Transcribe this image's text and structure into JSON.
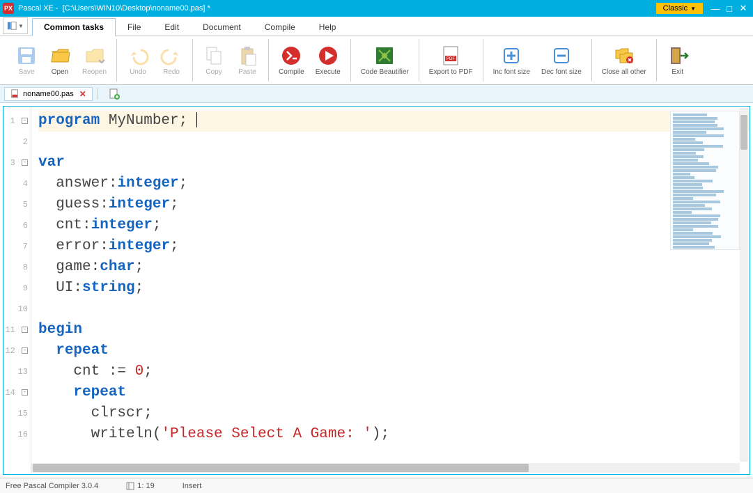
{
  "window": {
    "app_name": "Pascal XE",
    "file_path": "[C:\\Users\\WIN10\\Desktop\\noname00.pas] *",
    "theme_button": "Classic"
  },
  "menu": {
    "tabs": [
      "Common tasks",
      "File",
      "Edit",
      "Document",
      "Compile",
      "Help"
    ],
    "active_index": 0
  },
  "toolbar": {
    "groups": [
      {
        "items": [
          {
            "name": "save",
            "label": "Save",
            "icon": "save-icon",
            "disabled": true
          },
          {
            "name": "open",
            "label": "Open",
            "icon": "folder-open-icon",
            "disabled": false
          },
          {
            "name": "reopen",
            "label": "Reopen",
            "icon": "folder-dropdown-icon",
            "disabled": true
          }
        ]
      },
      {
        "items": [
          {
            "name": "undo",
            "label": "Undo",
            "icon": "undo-icon",
            "disabled": true
          },
          {
            "name": "redo",
            "label": "Redo",
            "icon": "redo-icon",
            "disabled": true
          }
        ]
      },
      {
        "items": [
          {
            "name": "copy",
            "label": "Copy",
            "icon": "copy-icon",
            "disabled": true
          },
          {
            "name": "paste",
            "label": "Paste",
            "icon": "paste-icon",
            "disabled": true
          }
        ]
      },
      {
        "items": [
          {
            "name": "compile",
            "label": "Compile",
            "icon": "compile-icon",
            "disabled": false
          },
          {
            "name": "execute",
            "label": "Execute",
            "icon": "execute-icon",
            "disabled": false
          }
        ]
      },
      {
        "items": [
          {
            "name": "code-beautifier",
            "label": "Code Beautifier",
            "icon": "beautifier-icon",
            "disabled": false
          }
        ]
      },
      {
        "items": [
          {
            "name": "export-pdf",
            "label": "Export to PDF",
            "icon": "pdf-icon",
            "disabled": false
          }
        ]
      },
      {
        "items": [
          {
            "name": "inc-font",
            "label": "Inc font size",
            "icon": "plus-icon",
            "disabled": false
          },
          {
            "name": "dec-font",
            "label": "Dec font size",
            "icon": "minus-icon",
            "disabled": false
          }
        ]
      },
      {
        "items": [
          {
            "name": "close-all-other",
            "label": "Close all other",
            "icon": "close-folders-icon",
            "disabled": false
          }
        ]
      },
      {
        "items": [
          {
            "name": "exit",
            "label": "Exit",
            "icon": "exit-icon",
            "disabled": false
          }
        ]
      }
    ]
  },
  "file_tabs": {
    "tabs": [
      {
        "name": "noname00.pas",
        "modified": true
      }
    ]
  },
  "editor": {
    "lines": [
      {
        "n": 1,
        "fold": "-",
        "tokens": [
          [
            "kw",
            "program"
          ],
          [
            "ident",
            " MyNumber"
          ],
          [
            "punct",
            ";"
          ]
        ],
        "hl": true,
        "caret_after": true
      },
      {
        "n": 2,
        "tokens": []
      },
      {
        "n": 3,
        "fold": "-",
        "tokens": [
          [
            "kw",
            "var"
          ]
        ]
      },
      {
        "n": 4,
        "tokens": [
          [
            "ident",
            "  answer"
          ],
          [
            "punct",
            ":"
          ],
          [
            "type",
            "integer"
          ],
          [
            "punct",
            ";"
          ]
        ]
      },
      {
        "n": 5,
        "tokens": [
          [
            "ident",
            "  guess"
          ],
          [
            "punct",
            ":"
          ],
          [
            "type",
            "integer"
          ],
          [
            "punct",
            ";"
          ]
        ]
      },
      {
        "n": 6,
        "tokens": [
          [
            "ident",
            "  cnt"
          ],
          [
            "punct",
            ":"
          ],
          [
            "type",
            "integer"
          ],
          [
            "punct",
            ";"
          ]
        ]
      },
      {
        "n": 7,
        "tokens": [
          [
            "ident",
            "  error"
          ],
          [
            "punct",
            ":"
          ],
          [
            "type",
            "integer"
          ],
          [
            "punct",
            ";"
          ]
        ]
      },
      {
        "n": 8,
        "tokens": [
          [
            "ident",
            "  game"
          ],
          [
            "punct",
            ":"
          ],
          [
            "type",
            "char"
          ],
          [
            "punct",
            ";"
          ]
        ]
      },
      {
        "n": 9,
        "tokens": [
          [
            "ident",
            "  UI"
          ],
          [
            "punct",
            ":"
          ],
          [
            "type",
            "string"
          ],
          [
            "punct",
            ";"
          ]
        ]
      },
      {
        "n": 10,
        "tokens": []
      },
      {
        "n": 11,
        "fold": "-",
        "tokens": [
          [
            "kw",
            "begin"
          ]
        ]
      },
      {
        "n": 12,
        "fold": "-",
        "tokens": [
          [
            "ident",
            "  "
          ],
          [
            "kw",
            "repeat"
          ]
        ]
      },
      {
        "n": 13,
        "tokens": [
          [
            "ident",
            "    cnt "
          ],
          [
            "punct",
            ":= "
          ],
          [
            "num",
            "0"
          ],
          [
            "punct",
            ";"
          ]
        ]
      },
      {
        "n": 14,
        "fold": "-",
        "tokens": [
          [
            "ident",
            "    "
          ],
          [
            "kw",
            "repeat"
          ]
        ]
      },
      {
        "n": 15,
        "tokens": [
          [
            "ident",
            "      clrscr"
          ],
          [
            "punct",
            ";"
          ]
        ]
      },
      {
        "n": 16,
        "tokens": [
          [
            "ident",
            "      writeln"
          ],
          [
            "punct",
            "("
          ],
          [
            "str",
            "'Please Select A Game: '"
          ],
          [
            "punct",
            ");"
          ]
        ]
      }
    ]
  },
  "status": {
    "compiler": "Free Pascal Compiler 3.0.4",
    "cursor_pos": "1: 19",
    "mode": "Insert"
  }
}
